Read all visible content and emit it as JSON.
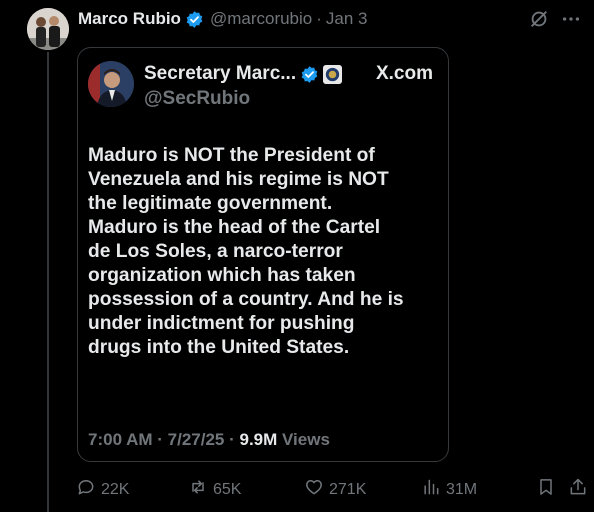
{
  "author": {
    "name": "Marco Rubio",
    "handle": "@marcorubio",
    "date": "Jan 3"
  },
  "quoted": {
    "name": "Secretary Marc...",
    "handle": "@SecRubio",
    "source": "X.com",
    "lines": [
      "Maduro is NOT the President of",
      "Venezuela and his regime is NOT",
      "the legitimate government.",
      "Maduro is the head of the Cartel",
      "de Los Soles, a narco-terror",
      "organization which has taken",
      "possession of a country.  And he is",
      "under indictment for pushing",
      "drugs into the United States."
    ],
    "timestamp": "7:00 AM · 7/27/25 · ",
    "views_count": "9.9M",
    "views_label": " Views"
  },
  "actions": {
    "replies": "22K",
    "reposts": "65K",
    "likes": "271K",
    "views": "31M"
  },
  "colors": {
    "background": "#000000",
    "text": "#e7e9ea",
    "muted": "#71767b",
    "verified": "#1d9bf0",
    "border": "#36393c"
  },
  "icons": [
    "grok-icon",
    "more-icon",
    "verified-icon",
    "state-dept-seal-icon",
    "reply-icon",
    "repost-icon",
    "like-icon",
    "views-icon",
    "bookmark-icon",
    "share-icon"
  ]
}
